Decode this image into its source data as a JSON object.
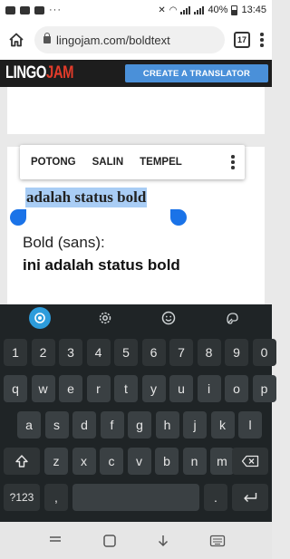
{
  "status_bar": {
    "battery": "40%",
    "time": "13:45",
    "dots": "···"
  },
  "browser": {
    "url": "lingojam.com/boldtext",
    "tab_count": "17"
  },
  "site": {
    "logo_main": "LINGO",
    "logo_accent": "JAM",
    "create_button": "CREATE A TRANSLATOR"
  },
  "context_menu": {
    "cut": "POTONG",
    "copy": "SALIN",
    "paste": "TEMPEL"
  },
  "content": {
    "selected_text": "adalah status bold",
    "sans_label": "Bold (sans):",
    "sans_output": "ini adalah status bold"
  },
  "keyboard": {
    "row1": [
      "1",
      "2",
      "3",
      "4",
      "5",
      "6",
      "7",
      "8",
      "9",
      "0"
    ],
    "row2": [
      "q",
      "w",
      "e",
      "r",
      "t",
      "y",
      "u",
      "i",
      "o",
      "p"
    ],
    "row3": [
      "a",
      "s",
      "d",
      "f",
      "g",
      "h",
      "j",
      "k",
      "l"
    ],
    "row4": [
      "z",
      "x",
      "c",
      "v",
      "b",
      "n",
      "m"
    ],
    "symbols_key": "?123",
    "comma_key": ",",
    "period_key": "."
  },
  "colors": {
    "accent_blue": "#4a90d9",
    "logo_red": "#e23b2a",
    "selection": "#a9cdf5",
    "handle": "#1a73e8"
  }
}
